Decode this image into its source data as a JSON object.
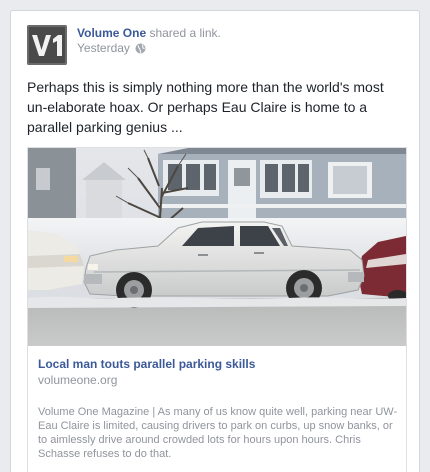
{
  "post": {
    "actor_name": "Volume One",
    "action_text": " shared a link.",
    "timestamp": "Yesterday",
    "body_text": "Perhaps this is simply nothing more than the world's most un-elaborate hoax. Or perhaps Eau Claire is home to a parallel parking genius ..."
  },
  "icons": {
    "privacy": "globe-icon",
    "avatar": "volume-one-logo"
  },
  "avatar_logo_text": "V1",
  "link": {
    "title": "Local man touts parallel parking skills",
    "domain": "volumeone.org",
    "description": "Volume One Magazine | As many of us know quite well, parking near UW-Eau Claire is limited, causing drivers to park on curbs, up snow banks, or to aimlessly drive around crowded lots for hours upon hours. Chris Schasse refuses to do that."
  },
  "colors": {
    "link_blue": "#3b5998",
    "meta_gray": "#90949c",
    "text_dark": "#1d2129"
  }
}
